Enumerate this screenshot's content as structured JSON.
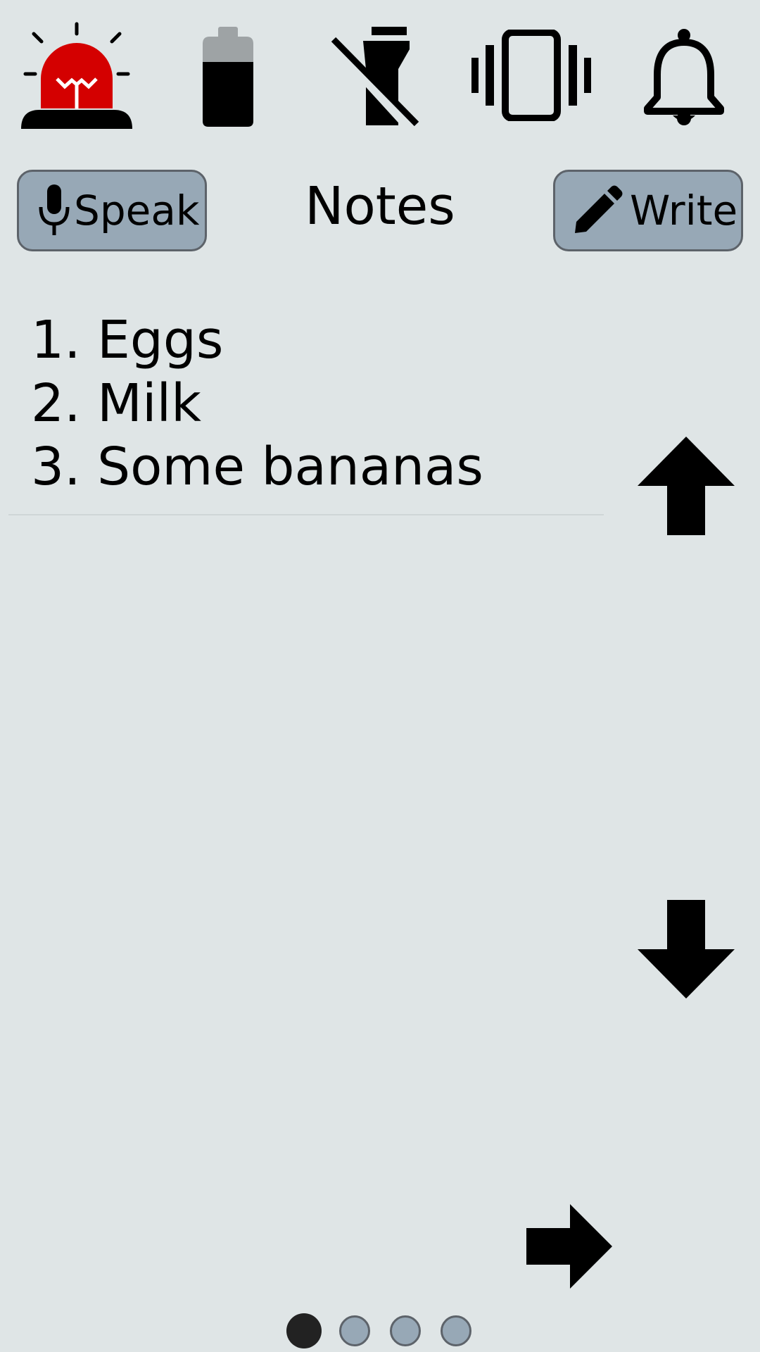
{
  "app": {
    "title": "Notes"
  },
  "status_icons": [
    {
      "name": "emergency-siren-icon",
      "color": "#d40000"
    },
    {
      "name": "battery-icon"
    },
    {
      "name": "flashlight-off-icon"
    },
    {
      "name": "vibrate-icon"
    },
    {
      "name": "bell-icon"
    }
  ],
  "toolbar": {
    "speak_label": "Speak",
    "write_label": "Write"
  },
  "notes": {
    "items": [
      "1. Eggs",
      "2. Milk",
      "3. Some bananas"
    ]
  },
  "navigation": {
    "scroll_up_icon": "arrow-up-icon",
    "scroll_down_icon": "arrow-down-icon",
    "next_page_icon": "arrow-right-icon"
  },
  "pager": {
    "total_pages": 4,
    "current_page": 1
  },
  "colors": {
    "background": "#dfe5e6",
    "button_fill": "#97a8b6",
    "button_border": "#5d636a",
    "alert_red": "#d40000"
  }
}
